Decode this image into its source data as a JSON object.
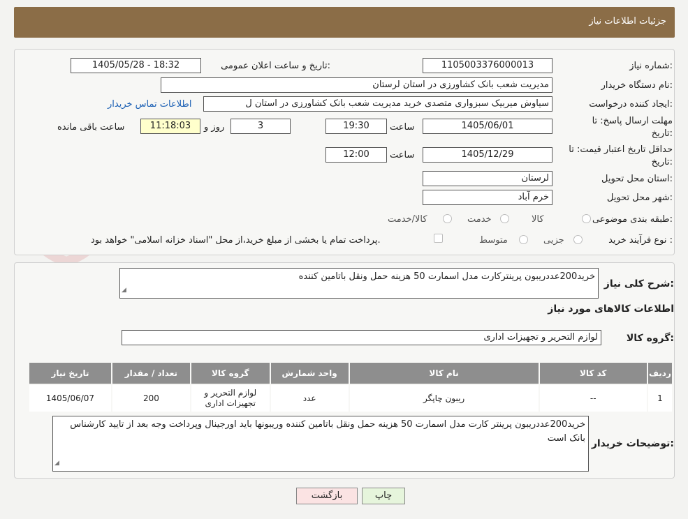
{
  "header": {
    "title": "جزئیات اطلاعات نیاز"
  },
  "watermark": {
    "text": "AriaTender.neT"
  },
  "fields": {
    "need_number_label": "شماره نیاز:",
    "need_number": "1105003376000013",
    "announce_label": "تاریخ و ساعت اعلان عمومی:",
    "announce_value": "1405/05/28 - 18:32",
    "buyer_org_label": "نام دستگاه خریدار:",
    "buyer_org": "مدیریت شعب بانک کشاورزی در استان لرستان",
    "requester_label": "ایجاد کننده درخواست:",
    "requester": "سیاوش میربیک سبزواری متصدی خرید مدیریت شعب بانک کشاورزی در استان ل",
    "contact_link": "اطلاعات تماس خریدار",
    "deadline_label_1": "مهلت ارسال پاسخ: تا",
    "deadline_label_2": "تاریخ:",
    "deadline_date": "1405/06/01",
    "time_label": "ساعت",
    "deadline_time": "19:30",
    "days": "3",
    "days_label": "روز و",
    "remaining": "11:18:03",
    "remaining_label": "ساعت باقی مانده",
    "validity_label_1": "حداقل تاریخ اعتبار قیمت: تا",
    "validity_label_2": "تاریخ:",
    "validity_date": "1405/12/29",
    "validity_time": "12:00",
    "province_label": "استان محل تحویل:",
    "province": "لرستان",
    "city_label": "شهر محل تحویل:",
    "city": "خرم آباد",
    "category_label": "طبقه بندی موضوعی:",
    "category_options": [
      "کالا",
      "خدمت",
      "کالا/خدمت"
    ],
    "process_label": "نوع فرآیند خرید :",
    "process_options": [
      "جزیی",
      "متوسط"
    ],
    "payment_note": "پرداخت تمام یا بخشی از مبلغ خرید،از محل \"اسناد خزانه اسلامی\" خواهد بود."
  },
  "summary": {
    "label": "شرح کلی نیاز:",
    "text": "خرید200عددریبون پرینترکارت مدل اسمارت 50 هزینه حمل ونقل باتامین کننده",
    "goods_info_title": "اطلاعات کالاهای مورد نیاز",
    "goods_group_label": "گروه کالا:",
    "goods_group": "لوازم التحریر و تجهیزات اداری"
  },
  "table": {
    "headers": [
      "ردیف",
      "کد کالا",
      "نام کالا",
      "واحد شمارش",
      "گروه کالا",
      "تعداد / مقدار",
      "تاریخ نیاز"
    ],
    "rows": [
      [
        "1",
        "--",
        "ریبون چاپگر",
        "عدد",
        "لوازم التحریر و تجهیزات اداری",
        "200",
        "1405/06/07"
      ]
    ]
  },
  "buyer_notes": {
    "label": "توضیحات خریدار:",
    "text": "خرید200عددریبون پرینتر کارت مدل اسمارت 50 هزینه حمل ونقل باتامین کننده وریبونها باید اورجینال وپرداخت وجه بعد از تایید کارشناس بانک است"
  },
  "buttons": {
    "print": "چاپ",
    "back": "بازگشت"
  },
  "colors": {
    "header": "#8b6d47",
    "table_header": "#8e8e8e",
    "print_btn": "#e6f5dc",
    "back_btn": "#fbe3e3",
    "link": "#1a5fb4"
  }
}
